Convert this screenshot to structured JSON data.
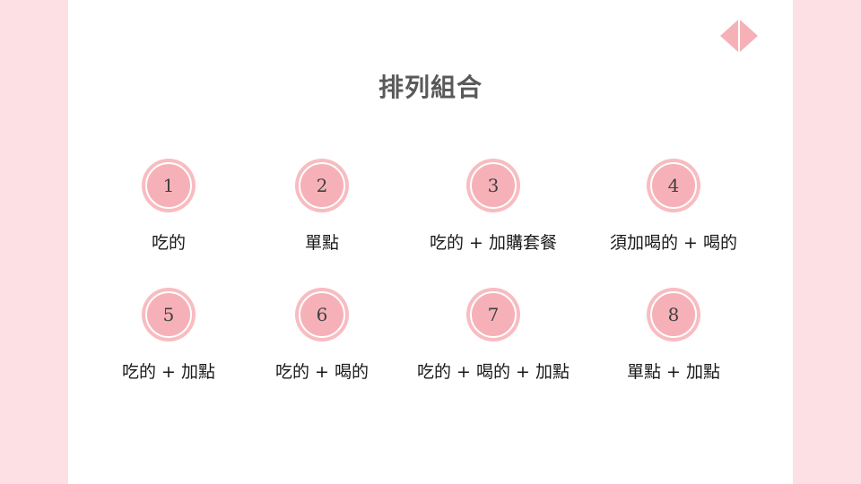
{
  "slide": {
    "title": "排列組合"
  },
  "nav": {
    "prev_icon": "triangle-left-icon",
    "next_icon": "triangle-right-icon",
    "color": "#f6b1b8"
  },
  "theme": {
    "band_color": "#fde0e3",
    "badge_color": "#f6b1b8"
  },
  "items": [
    {
      "number": "1",
      "label": "吃的"
    },
    {
      "number": "2",
      "label": "單點"
    },
    {
      "number": "3",
      "label": "吃的 + 加購套餐"
    },
    {
      "number": "4",
      "label": "須加喝的 + 喝的"
    },
    {
      "number": "5",
      "label": "吃的 + 加點"
    },
    {
      "number": "6",
      "label": "吃的 + 喝的"
    },
    {
      "number": "7",
      "label": "吃的 + 喝的 + 加點"
    },
    {
      "number": "8",
      "label": "單點 + 加點"
    }
  ]
}
